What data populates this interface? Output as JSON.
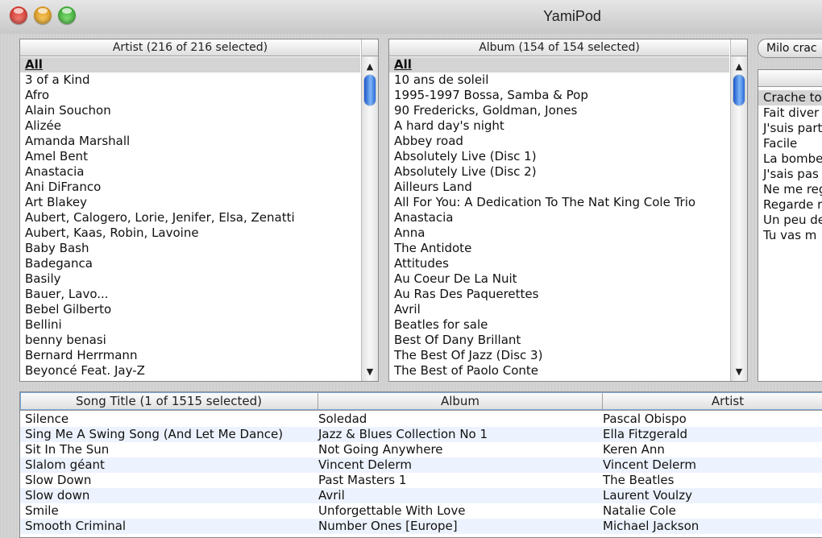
{
  "window": {
    "title": "YamiPod"
  },
  "artist": {
    "header": "Artist (216 of 216 selected)",
    "items": [
      "All",
      "3 of a Kind",
      "Afro",
      "Alain Souchon",
      "Alizée",
      "Amanda Marshall",
      "Amel Bent",
      "Anastacia",
      "Ani DiFranco",
      "Art Blakey",
      "Aubert, Calogero, Lorie, Jenifer, Elsa, Zenatti",
      "Aubert, Kaas, Robin, Lavoine",
      "Baby Bash",
      "Badeganca",
      "Basily",
      "Bauer, Lavo...",
      "Bebel Gilberto",
      "Bellini",
      "benny benasi",
      "Bernard Herrmann",
      "Beyoncé Feat. Jay-Z"
    ]
  },
  "album": {
    "header": "Album (154 of 154 selected)",
    "items": [
      "All",
      "10 ans de soleil",
      "1995-1997 Bossa, Samba & Pop",
      "90 Fredericks, Goldman, Jones",
      "A hard day's night",
      "Abbey road",
      "Absolutely Live (Disc 1)",
      "Absolutely Live (Disc 2)",
      "Ailleurs Land",
      "All For You: A Dedication To The Nat King Cole Trio",
      "Anastacia",
      "Anna",
      "The Antidote",
      "Attitudes",
      "Au Coeur De La Nuit",
      "Au Ras Des Paquerettes",
      "Avril",
      "Beatles for sale",
      "Best Of Dany Brillant",
      "The Best Of Jazz (Disc 3)",
      "The Best of Paolo Conte"
    ]
  },
  "playlist": {
    "button_label": "Milo crac",
    "items": [
      "Crache to",
      "Fait diver",
      "J'suis part",
      "Facile",
      "La bombe",
      "J'sais pas",
      "Ne me reg",
      "Regarde r",
      "Un peu de",
      "Tu vas m"
    ]
  },
  "songs": {
    "columns": [
      "Song Title (1 of 1515 selected)",
      "Album",
      "Artist"
    ],
    "rows": [
      [
        "Silence",
        "Soledad",
        "Pascal Obispo"
      ],
      [
        "Sing Me A Swing Song (And Let Me Dance)",
        "Jazz & Blues Collection No 1",
        "Ella Fitzgerald"
      ],
      [
        "Sit In The Sun",
        "Not Going Anywhere",
        "Keren Ann"
      ],
      [
        "Slalom géant",
        "Vincent Delerm",
        "Vincent Delerm"
      ],
      [
        "Slow Down",
        "Past Masters 1",
        "The Beatles"
      ],
      [
        "Slow down",
        "Avril",
        "Laurent Voulzy"
      ],
      [
        "Smile",
        "Unforgettable With Love",
        "Natalie Cole"
      ],
      [
        "Smooth Criminal",
        "Number Ones [Europe]",
        "Michael Jackson"
      ]
    ]
  },
  "colors": {
    "close": "#e0443c",
    "minimize": "#e9a429",
    "zoom": "#3fb83a",
    "selection": "#d4d4d4",
    "stripe": "#edf3fe"
  }
}
